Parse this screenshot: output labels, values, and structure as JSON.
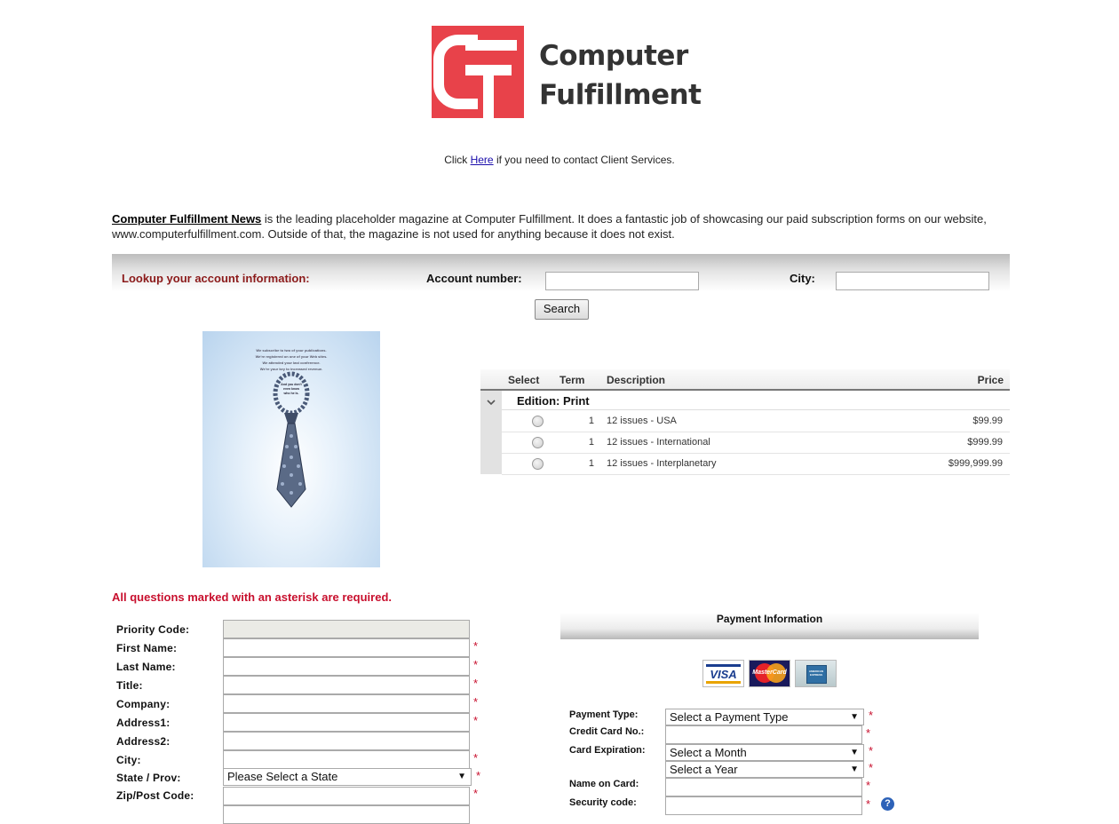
{
  "brand": {
    "name_line1": "Computer",
    "name_line2": "Fulfillment",
    "color": "#e8424a"
  },
  "contact": {
    "prefix": "Click",
    "link": "Here",
    "suffix": "if you need to contact Client Services."
  },
  "intro": {
    "publication": "Computer Fulfillment News",
    "text": "is the leading placeholder magazine at Computer Fulfillment. It does a fantastic job of showcasing our paid subscription forms on our website, www.computerfulfillment.com. Outside of that, the magazine is not used for anything because it does not exist."
  },
  "lookup": {
    "title": "Lookup your account information:",
    "account_label": "Account number:",
    "account_value": "",
    "city_label": "City:",
    "city_value": "",
    "search_label": "Search"
  },
  "cover": {
    "lines": [
      "We subscribe to two of your publications.",
      "We're registered on one of your Web sites.",
      "We attended your last conference.",
      "We're your key to increased revenue."
    ],
    "bubble_lines": [
      "And you don't",
      "even know",
      "who he is."
    ]
  },
  "offers": {
    "columns": {
      "select": "Select",
      "term": "Term",
      "description": "Description",
      "price": "Price"
    },
    "edition": "Edition: Print",
    "rows": [
      {
        "term": "1",
        "description": "12 issues - USA",
        "price": "$99.99",
        "selected": false
      },
      {
        "term": "1",
        "description": "12 issues - International",
        "price": "$999.99",
        "selected": false
      },
      {
        "term": "1",
        "description": "12 issues - Interplanetary",
        "price": "$999,999.99",
        "selected": false
      }
    ]
  },
  "required_note": "All questions marked with an asterisk are required.",
  "form": {
    "fields": [
      {
        "label": "Priority Code:",
        "value": "",
        "required": false,
        "disabled": true
      },
      {
        "label": "First Name:",
        "value": "",
        "required": true
      },
      {
        "label": "Last Name:",
        "value": "",
        "required": true
      },
      {
        "label": "Title:",
        "value": "",
        "required": true
      },
      {
        "label": "Company:",
        "value": "",
        "required": true
      },
      {
        "label": "Address1:",
        "value": "",
        "required": true
      },
      {
        "label": "Address2:",
        "value": "",
        "required": false
      },
      {
        "label": "City:",
        "value": "",
        "required": true
      },
      {
        "label": "State / Prov:",
        "value": "Please Select a State",
        "required": true,
        "type": "select"
      },
      {
        "label": "Zip/Post Code:",
        "value": "",
        "required": true
      }
    ],
    "asterisk": "*"
  },
  "payment": {
    "title": "Payment Information",
    "cards": [
      "VISA",
      "MasterCard",
      "AMERICAN EXPRESS"
    ],
    "type_label": "Payment Type:",
    "type_value": "Select a Payment Type",
    "card_number_label": "Credit Card No.:",
    "expiration_label": "Card Expiration:",
    "month_value": "Select a Month",
    "year_value": "Select a Year",
    "name_label": "Name on Card:",
    "security_label": "Security code:",
    "help": "?"
  }
}
